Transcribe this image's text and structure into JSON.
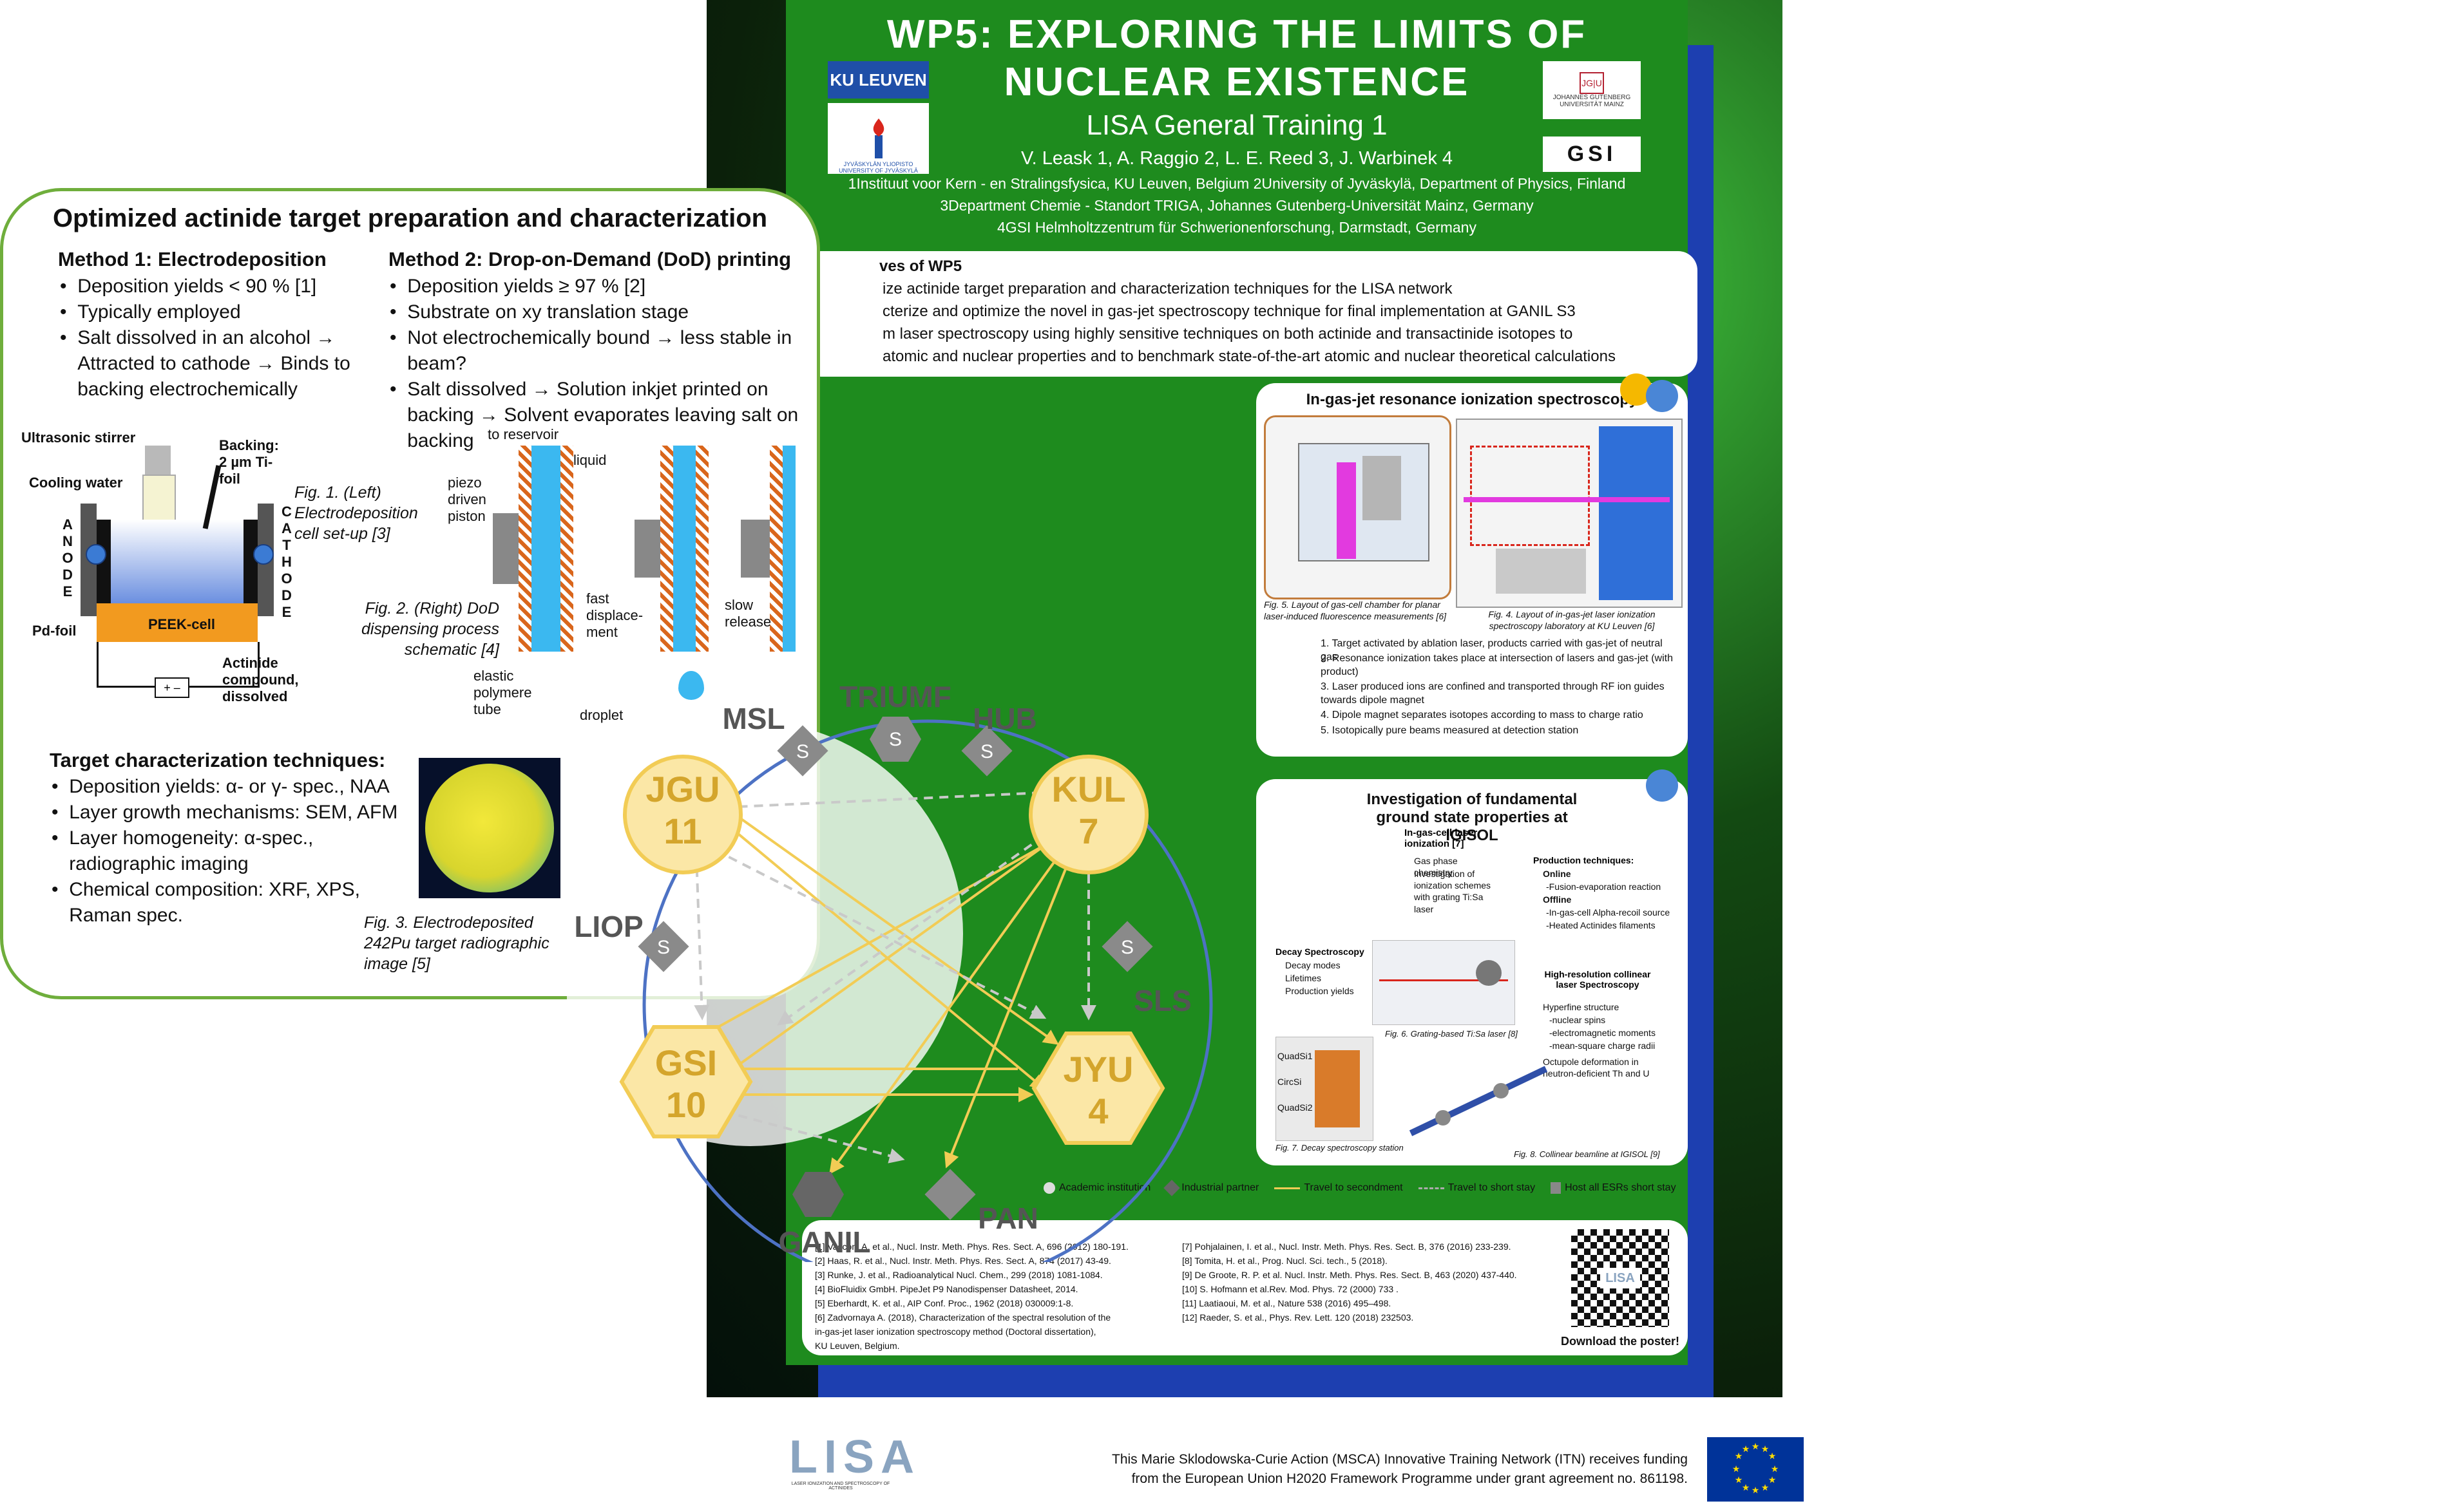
{
  "poster": {
    "title_line1": "WP5: EXPLORING THE LIMITS OF",
    "title_line2": "NUCLEAR EXISTENCE",
    "subtitle": "LISA General Training 1",
    "authors": "V. Leask 1, A. Raggio 2, L. E. Reed 3, J. Warbinek 4",
    "affil1": "1Instituut voor Kern - en Stralingsfysica, KU Leuven, Belgium   2University of Jyväskylä, Department of Physics, Finland",
    "affil2": "3Department Chemie - Standort TRIGA, Johannes Gutenberg-Universität Mainz, Germany",
    "affil3": "4GSI Helmholtzzentrum für Schwerionenforschung, Darmstadt, Germany",
    "logos": {
      "kul": "KU LEUVEN",
      "jyu": "JYVÄSKYLÄN YLIOPISTO UNIVERSITY OF JYVÄSKYLÄ",
      "jgu": "JOHANNES GUTENBERG UNIVERSITÄT MAINZ",
      "gsi": "GSI"
    },
    "objectives_title": "ves of WP5",
    "objectives": [
      "ize actinide target preparation and characterization techniques for the LISA network",
      "cterize and optimize the novel in gas-jet spectroscopy technique for final implementation at GANIL S3",
      "m laser spectroscopy using highly sensitive techniques on both actinide and transactinide isotopes to",
      "atomic and nuclear properties and to benchmark state-of-the-art atomic and nuclear theoretical calculations"
    ],
    "gasjet_title": "In-gas-jet resonance ionization spectroscopy",
    "gasjet_fig5": "Fig. 5. Layout of gas-cell chamber for planar laser-induced fluorescence measurements [6]",
    "gasjet_fig4": "Fig. 4. Layout of in-gas-jet laser ionization spectroscopy laboratory at KU Leuven [6]",
    "gasjet_steps": [
      "1.  Target activated by ablation laser, products carried with gas-jet of neutral gas",
      "2.  Resonance ionization takes place at intersection of lasers and gas-jet (with product)",
      "3.  Laser produced ions are confined and transported through RF ion guides towards dipole magnet",
      "4.  Dipole magnet separates isotopes according to mass to charge ratio",
      "5.  Isotopically pure beams measured at detection station"
    ],
    "igisol_title": "Investigation of fundamental ground state properties at IGISOL",
    "igisol_ingas": "In-gas-cell laser ionization [7]",
    "igisol_ingas_items": [
      "Gas phase chemistry",
      "Investigation of ionization schemes with grating Ti:Sa laser"
    ],
    "igisol_prod_title": "Production techniques:",
    "igisol_prod_items": [
      "Online",
      "-Fusion-evaporation reaction",
      "Offline",
      "-In-gas-cell Alpha-recoil source",
      "-Heated Actinides filaments"
    ],
    "igisol_decay_title": "Decay Spectroscopy",
    "igisol_decay_items": [
      "Decay modes",
      "Lifetimes",
      "Production yields"
    ],
    "igisol_collinear_title": "High-resolution collinear laser Spectroscopy",
    "igisol_collinear_items": [
      "Hyperfine structure",
      "-nuclear spins",
      "-electromagnetic moments",
      "-mean-square charge radii",
      "Octupole deformation in neutron-deficient Th and U"
    ],
    "igisol_fig6": "Fig. 6. Grating-based Ti:Sa laser [8]",
    "igisol_fig7": "Fig. 7. Decay spectroscopy station",
    "igisol_fig8": "Fig. 8. Collinear beamline at IGISOL [9]",
    "igisol_labels": [
      "QuadSi1",
      "CircSi",
      "QuadSi2"
    ],
    "legend": [
      "Academic institution",
      "Industrial partner",
      "Travel to secondment",
      "Travel to short stay",
      "Host all ESRs short stay"
    ],
    "refs_left": [
      "[1]  Vascon, A. et al., Nucl. Instr. Meth. Phys. Res. Sect. A, 696 (2012) 180-191.",
      "[2]  Haas, R. et al., Nucl. Instr. Meth. Phys. Res. Sect. A, 874 (2017) 43-49.",
      "[3]  Runke, J. et al., Radioanalytical Nucl. Chem., 299 (2018) 1081-1084.",
      "[4]  BioFluidix GmbH. PipeJet P9 Nanodispenser Datasheet, 2014.",
      "[5]  Eberhardt, K. et al., AIP Conf. Proc., 1962 (2018) 030009:1-8.",
      "[6]  Zadvornaya A. (2018), Characterization of the spectral resolution of the",
      "       in-gas-jet laser ionization spectroscopy method (Doctoral dissertation),",
      "       KU Leuven, Belgium."
    ],
    "refs_right": [
      "[7]  Pohjalainen, I. et al., Nucl. Instr. Meth. Phys. Res. Sect. B, 376 (2016) 233-239.",
      "[8]  Tomita, H. et al., Prog. Nucl. Sci. tech., 5 (2018).",
      "[9]  De Groote, R. P. et al. Nucl. Instr. Meth. Phys. Res. Sect. B, 463 (2020) 437-440.",
      "[10] S. Hofmann et al.Rev. Mod. Phys. 72 (2000) 733 .",
      "[11] Laatiaoui, M. et al., Nature 538 (2016) 495–498.",
      "[12] Raeder, S. et al., Phys. Rev. Lett. 120 (2018) 232503."
    ],
    "download": "Download the poster!",
    "qr_label": "LISA"
  },
  "lens": {
    "title": "Optimized actinide target preparation and characterization",
    "m1_title": "Method 1: Electrodeposition",
    "m1_items": [
      "Deposition yields < 90 % [1]",
      "Typically employed",
      "Salt dissolved in an alcohol → Attracted to cathode → Binds to backing electrochemically"
    ],
    "m2_title": "Method 2: Drop-on-Demand (DoD) printing",
    "m2_items": [
      "Deposition yields ≥ 97 % [2]",
      "Substrate on xy translation stage",
      "Not electrochemically bound → less stable in beam?",
      "Salt dissolved → Solution inkjet printed on backing → Solvent evaporates leaving salt on backing"
    ],
    "cell_labels": {
      "stirrer": "Ultrasonic stirrer",
      "backing": "Backing:",
      "backing2": "2 µm Ti-foil",
      "cooling": "Cooling water",
      "anode": "ANODE",
      "cathode": "CATHODE",
      "pd": "Pd-foil",
      "peek": "PEEK-cell",
      "actinide": "Actinide compound, dissolved"
    },
    "fig1": "Fig. 1. (Left) Electrodeposition cell set-up [3]",
    "fig2": "Fig. 2. (Right) DoD dispensing process schematic [4]",
    "dod_labels": {
      "reservoir": "to reservoir",
      "liquid": "liquid",
      "piston": "piezo driven piston",
      "fast": "fast displace-ment",
      "slow": "slow release",
      "elastic": "elastic polymere tube",
      "droplet": "droplet"
    },
    "char_title": "Target characterization techniques:",
    "char_items": [
      "Deposition yields: α- or γ- spec., NAA",
      "Layer growth mechanisms: SEM, AFM",
      "Layer homogeneity: α-spec., radiographic imaging",
      "Chemical composition: XRF, XPS, Raman spec."
    ],
    "fig3": "Fig. 3. Electrodeposited 242Pu target radiographic image [5]"
  },
  "network": {
    "nodes": [
      {
        "name": "JGU",
        "num": "11"
      },
      {
        "name": "KUL",
        "num": "7"
      },
      {
        "name": "GSI",
        "num": "10"
      },
      {
        "name": "JYU",
        "num": "4"
      }
    ],
    "sites": [
      "TRIUMF",
      "MSL",
      "HUB",
      "LIOP",
      "SLS",
      "GANIL",
      "PAN"
    ],
    "short_stay": "S"
  },
  "footer": {
    "lisa": "LISA",
    "lisa_sub": "LASER IONIZATION AND SPECTROSCOPY OF ACTINIDES",
    "funding1": "This Marie Sklodowska-Curie Action (MSCA) Innovative Training Network (ITN) receives funding",
    "funding2": "from the European Union H2020 Framework Programme under grant agreement no. 861198."
  },
  "colors": {
    "poster_green": "#1e8b1e",
    "accent_gold": "#d4a52c",
    "lens_border": "#6fae3c",
    "eu_blue": "#003399"
  }
}
